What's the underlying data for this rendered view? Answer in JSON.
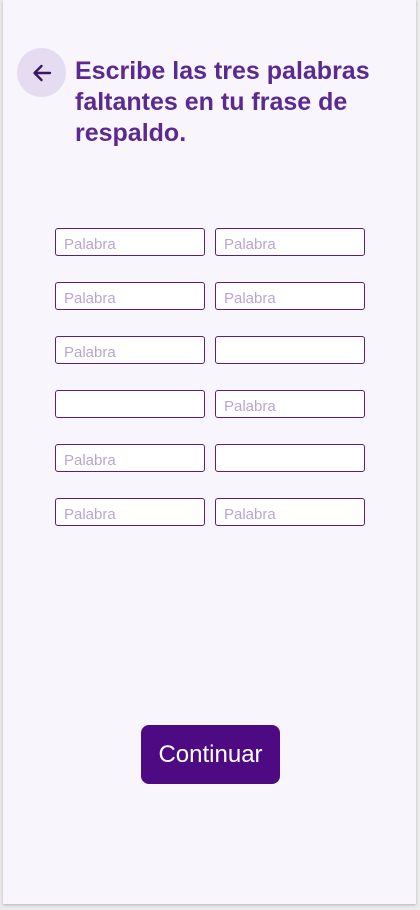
{
  "header": {
    "back_icon": "arrow-left-icon",
    "title": "Escribe las tres palabras faltantes en tu frase de respaldo."
  },
  "words": {
    "placeholder": "Palabra",
    "rows": [
      [
        {
          "value": "",
          "placeholder": "Palabra"
        },
        {
          "value": "",
          "placeholder": "Palabra"
        }
      ],
      [
        {
          "value": "",
          "placeholder": "Palabra"
        },
        {
          "value": "",
          "placeholder": "Palabra"
        }
      ],
      [
        {
          "value": "",
          "placeholder": "Palabra"
        },
        {
          "value": "",
          "placeholder": ""
        }
      ],
      [
        {
          "value": "",
          "placeholder": ""
        },
        {
          "value": "",
          "placeholder": "Palabra"
        }
      ],
      [
        {
          "value": "",
          "placeholder": "Palabra"
        },
        {
          "value": "",
          "placeholder": ""
        }
      ],
      [
        {
          "value": "",
          "placeholder": "Palabra"
        },
        {
          "value": "",
          "placeholder": "Palabra"
        }
      ]
    ]
  },
  "footer": {
    "continue_label": "Continuar"
  },
  "colors": {
    "background": "#f8f5fd",
    "title": "#5b2a91",
    "primary_button": "#4d0a82",
    "back_button_bg": "#e6dcf1",
    "input_border": "#5c1c8c",
    "placeholder": "#b9a6cf"
  }
}
